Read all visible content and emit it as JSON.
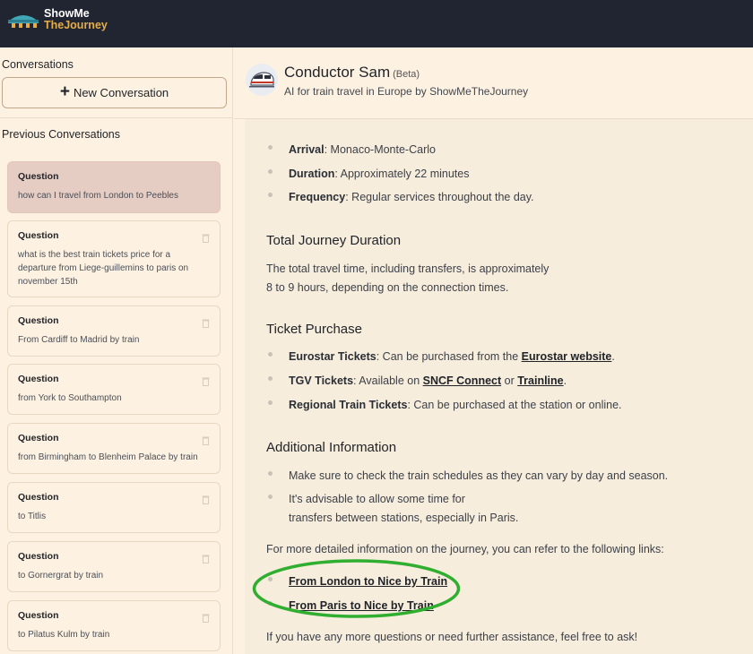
{
  "app": {
    "logo_line1": "ShowMe",
    "logo_line2": "TheJourney"
  },
  "sidebar": {
    "conversations_heading": "Conversations",
    "new_conversation_label": "New Conversation",
    "previous_heading": "Previous Conversations",
    "items": [
      {
        "title": "Question",
        "text": "how can I travel from London to Peebles"
      },
      {
        "title": "Question",
        "text": "what is the best train tickets price for a departure from Liege-guillemins to paris on november 15th"
      },
      {
        "title": "Question",
        "text": "From Cardiff to Madrid by train"
      },
      {
        "title": "Question",
        "text": "from York to Southampton"
      },
      {
        "title": "Question",
        "text": "from Birmingham to Blenheim Palace by train"
      },
      {
        "title": "Question",
        "text": "to Titlis"
      },
      {
        "title": "Question",
        "text": "to Gornergrat by train"
      },
      {
        "title": "Question",
        "text": "to Pilatus Kulm by train"
      }
    ]
  },
  "chat": {
    "bot_name": "Conductor Sam",
    "beta": "(Beta)",
    "subtitle": "AI for train travel in Europe by ShowMeTheJourney"
  },
  "message": {
    "arrival_label": "Arrival",
    "arrival_value": ": Monaco-Monte-Carlo",
    "duration_label": "Duration",
    "duration_value": ": Approximately 22 minutes",
    "frequency_label": "Frequency",
    "frequency_value": ": Regular services throughout the day.",
    "total_heading": "Total Journey Duration",
    "total_line1": "The total travel time, including transfers, is approximately",
    "total_line2": "8 to 9 hours, depending on the connection times.",
    "ticket_heading": "Ticket Purchase",
    "eurostar_label": "Eurostar Tickets",
    "eurostar_text": ": Can be purchased from the ",
    "eurostar_link": "Eurostar website",
    "eurostar_end": ".",
    "tgv_label": "TGV Tickets",
    "tgv_text": ": Available on ",
    "sncf_link": "SNCF Connect",
    "or_text": " or ",
    "trainline_link": "Trainline",
    "tgv_end": ".",
    "regional_label": "Regional Train Tickets",
    "regional_text": ": Can be purchased at the station or online.",
    "additional_heading": "Additional Information",
    "additional_1": "Make sure to check the train schedules as they can vary by day and season.",
    "additional_2a": "It's advisable to allow some time for",
    "additional_2b": "transfers between stations, especially in Paris.",
    "links_intro": "For more detailed information on the journey, you can refer to the following links:",
    "link_1": "From London to Nice by Train",
    "link_2": "From Paris to Nice by Train",
    "closing": "If you have any more questions or need further assistance, feel free to ask!"
  },
  "colors": {
    "topbar": "#202531",
    "background": "#fdf1e1",
    "active_card": "#e6cdc4",
    "highlight_ellipse": "#2fae2f",
    "logo_accent": "#e7ad45"
  }
}
